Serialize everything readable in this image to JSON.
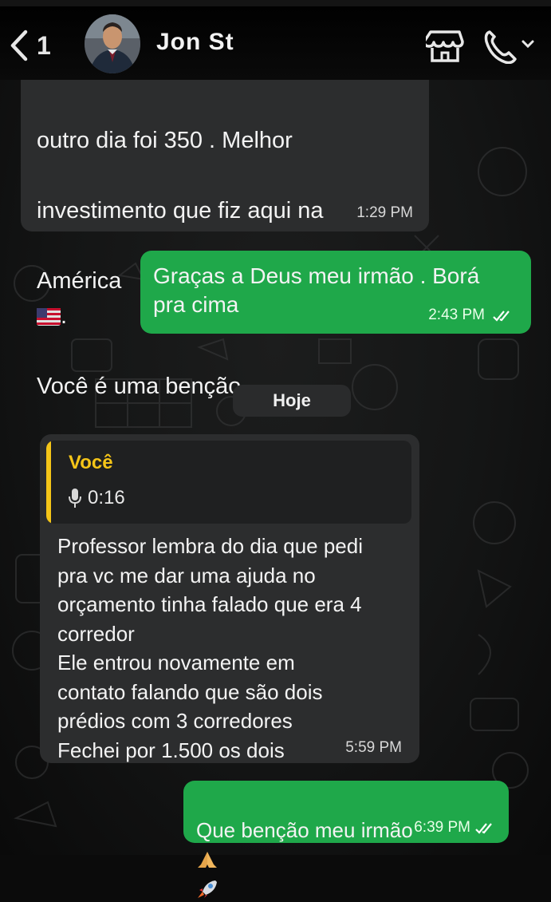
{
  "header": {
    "back_count": "1",
    "contact_name": "Jon St"
  },
  "messages": [
    {
      "direction": "incoming",
      "text_lines": [
        "outro dia foi 350 . Melhor",
        "investimento que fiz aqui na",
        "América",
        "Você é uma benção ."
      ],
      "flag_emoji": "us-flag",
      "time": "1:29 PM"
    },
    {
      "direction": "outgoing",
      "text": "Graças a Deus meu irmão . Borá\npra cima",
      "time": "2:43 PM",
      "status": "read"
    },
    {
      "direction": "incoming",
      "quote": {
        "author": "Você",
        "duration": "0:16"
      },
      "text": "Professor lembra do dia que pedi\npra vc me dar uma ajuda no\norçamento tinha falado que era 4\ncorredor\nEle entrou novamente em\ncontato falando que são dois\nprédios com 3  corredores\nFechei por 1.500 os dois",
      "time": "5:59 PM"
    },
    {
      "direction": "outgoing",
      "text": "Que benção meu irmão",
      "emojis": [
        "folded-hands",
        "rocket"
      ],
      "time": "6:39 PM",
      "status": "read"
    }
  ],
  "day_divider": "Hoje",
  "colors": {
    "outgoing_bubble": "#1fa84a",
    "incoming_bubble": "#2c2d2e",
    "quote_accent": "#f5c518",
    "read_ticks": "#ffffff"
  }
}
